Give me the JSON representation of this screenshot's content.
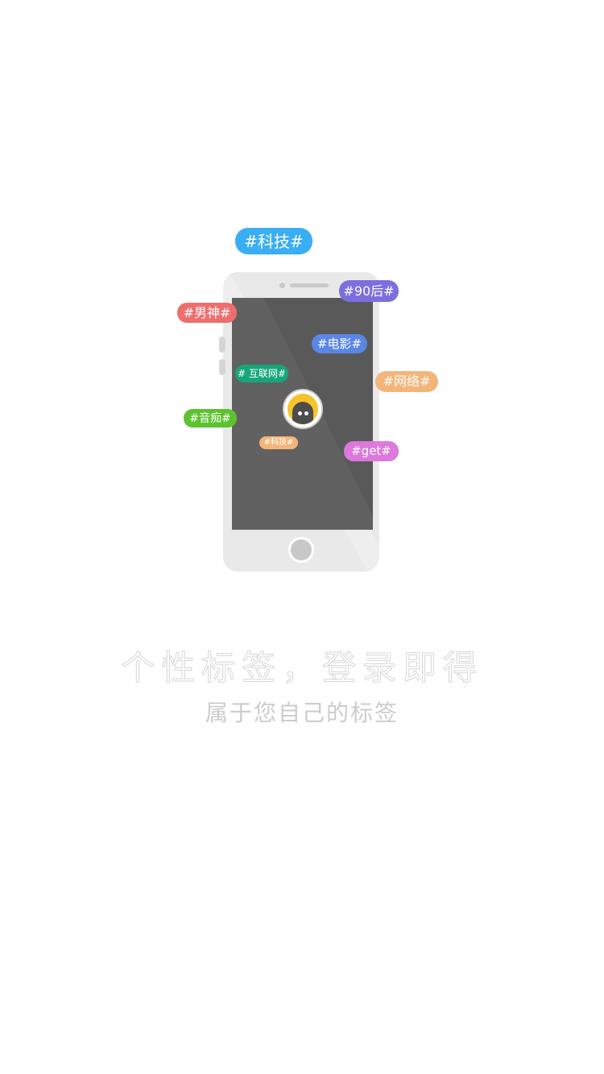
{
  "tags": [
    {
      "id": "tag-keji-large",
      "text": "#科技#",
      "color": "#3aaef2"
    },
    {
      "id": "tag-90hou",
      "text": "#90后#",
      "color": "#7b6fe0"
    },
    {
      "id": "tag-nanshen",
      "text": "#男神#",
      "color": "#ee6e6e"
    },
    {
      "id": "tag-dianying",
      "text": "#电影#",
      "color": "#5a86e6"
    },
    {
      "id": "tag-hulianwang",
      "text": "# 互联网#",
      "color": "#17a67a"
    },
    {
      "id": "tag-wangluo",
      "text": "#网络#",
      "color": "#f3b57a"
    },
    {
      "id": "tag-yinchi",
      "text": "#音痴#",
      "color": "#5cc22e"
    },
    {
      "id": "tag-keji-small",
      "text": "#科技#",
      "color": "#f3b57a"
    },
    {
      "id": "tag-get",
      "text": "#get#",
      "color": "#dd78dd"
    }
  ],
  "caption": {
    "title": "个性标签，登录即得",
    "subtitle": "属于您自己的标签"
  },
  "icons": {
    "avatar": "avatar-icon"
  }
}
